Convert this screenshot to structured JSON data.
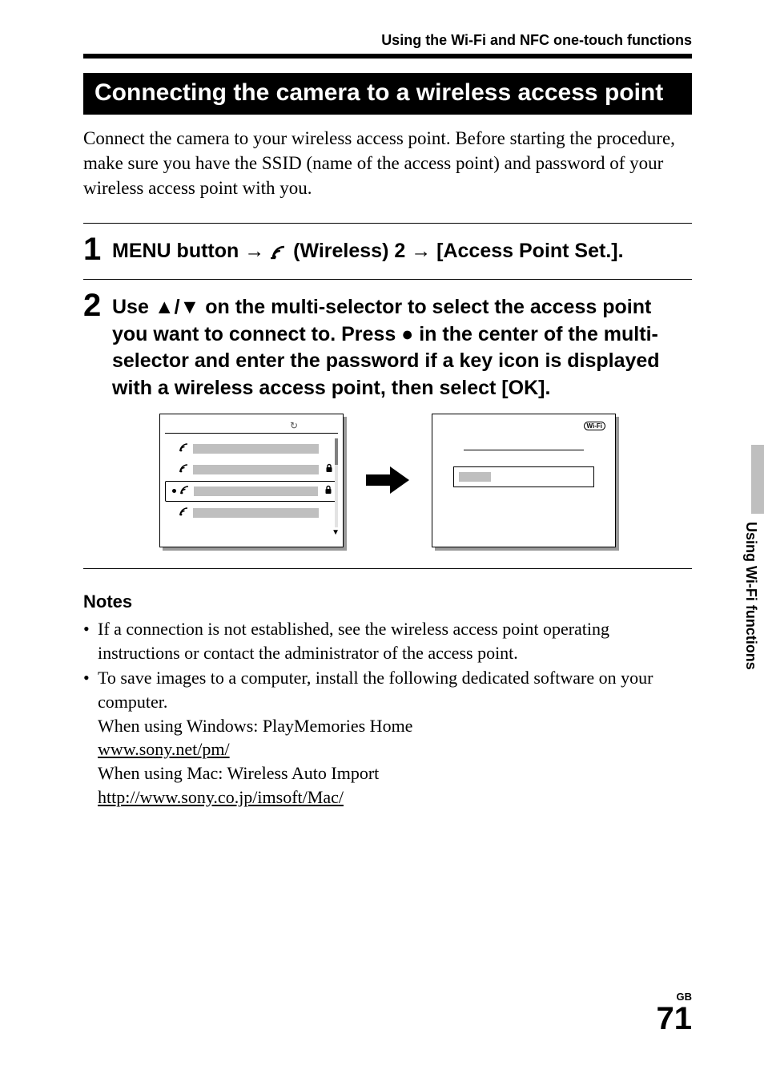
{
  "header": {
    "label": "Using the Wi-Fi and NFC one-touch functions"
  },
  "section_title": "Connecting the camera to a wireless access point",
  "intro": "Connect the camera to your wireless access point. Before starting the procedure, make sure you have the SSID (name of the access point) and password of your wireless access point with you.",
  "steps": {
    "s1": {
      "num": "1",
      "pre": "MENU button ",
      "mid1": " (Wireless) 2 ",
      "mid2": " [Access Point Set.]."
    },
    "s2": {
      "num": "2",
      "l1a": "Use ",
      "l1b": "/",
      "l1c": " on the multi-selector to select the access point you want to connect to. Press ",
      "l1d": " in the center of the multi-selector and enter the password if a key icon is displayed with a wireless access point, then select [OK]."
    }
  },
  "screen2": {
    "wifi_badge": "Wi-Fi"
  },
  "notes": {
    "heading": "Notes",
    "n1": "If a connection is not established, see the wireless access point operating instructions or contact the administrator of the access point.",
    "n2": "To save images to a computer, install the following dedicated software on your computer.",
    "n2_win": "When using Windows: PlayMemories Home",
    "n2_win_link": "www.sony.net/pm/",
    "n2_mac": "When using Mac: Wireless Auto Import",
    "n2_mac_link": "http://www.sony.co.jp/imsoft/Mac/"
  },
  "side_tab": "Using Wi-Fi functions",
  "footer": {
    "region": "GB",
    "page": "71"
  }
}
